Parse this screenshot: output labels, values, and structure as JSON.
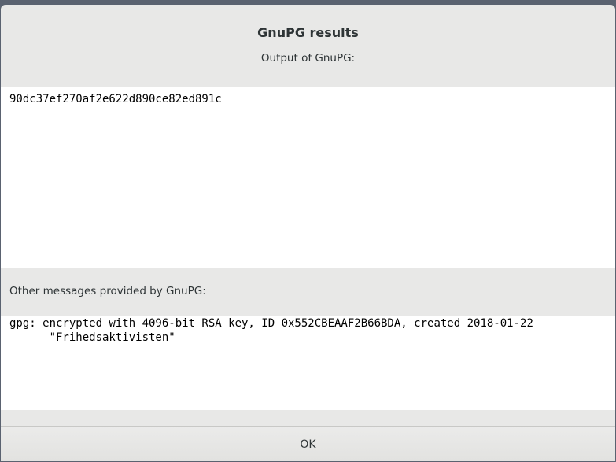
{
  "dialog": {
    "title": "GnuPG results",
    "output_label": "Output of GnuPG:",
    "output_text": "90dc37ef270af2e622d890ce82ed891c",
    "messages_label": "Other messages provided by GnuPG:",
    "messages_text": "gpg: encrypted with 4096-bit RSA key, ID 0x552CBEAAF2B66BDA, created 2018-01-22\n      \"Frihedsaktivisten\"",
    "ok_label": "OK"
  },
  "colors": {
    "dialog_background": "#e8e8e7",
    "text_area_background": "#ffffff",
    "text": "#2e3436"
  }
}
